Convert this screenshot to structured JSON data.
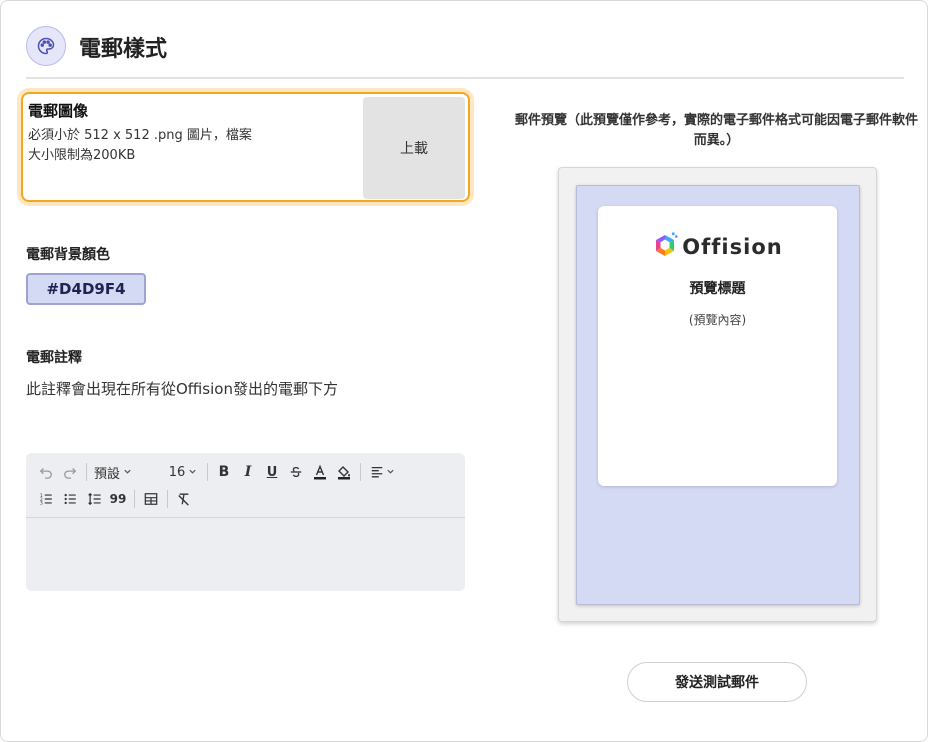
{
  "header": {
    "title": "電郵樣式",
    "icon": "palette-icon"
  },
  "logo_section": {
    "title": "電郵圖像",
    "description": "必須小於 512 x 512 .png 圖片，檔案大小限制為200KB",
    "upload_label": "上載"
  },
  "background_section": {
    "label": "電郵背景顏色",
    "color_value": "#D4D9F4"
  },
  "note_section": {
    "label": "電郵註釋",
    "description": "此註釋會出現在所有從Offision發出的電郵下方"
  },
  "editor": {
    "font_family": "預設",
    "font_size": "16",
    "toolbar_row1": [
      "undo-icon",
      "redo-icon",
      "font-family-select",
      "font-size-select",
      "bold-icon",
      "italic-icon",
      "underline-icon",
      "strikethrough-icon",
      "text-color-icon",
      "highlight-icon",
      "align-icon"
    ],
    "toolbar_row2": [
      "ordered-list-icon",
      "bullet-list-icon",
      "line-height-icon",
      "quote-icon",
      "table-icon",
      "clear-format-icon"
    ],
    "content": ""
  },
  "preview": {
    "caption": "郵件預覽（此預覽僅作參考，實際的電子郵件格式可能因電子郵件軟件而異。）",
    "brand_name": "Offision",
    "title": "預覽標題",
    "content": "(預覽內容)",
    "background_color": "#D4D9F4"
  },
  "actions": {
    "send_test_label": "發送測試郵件"
  }
}
